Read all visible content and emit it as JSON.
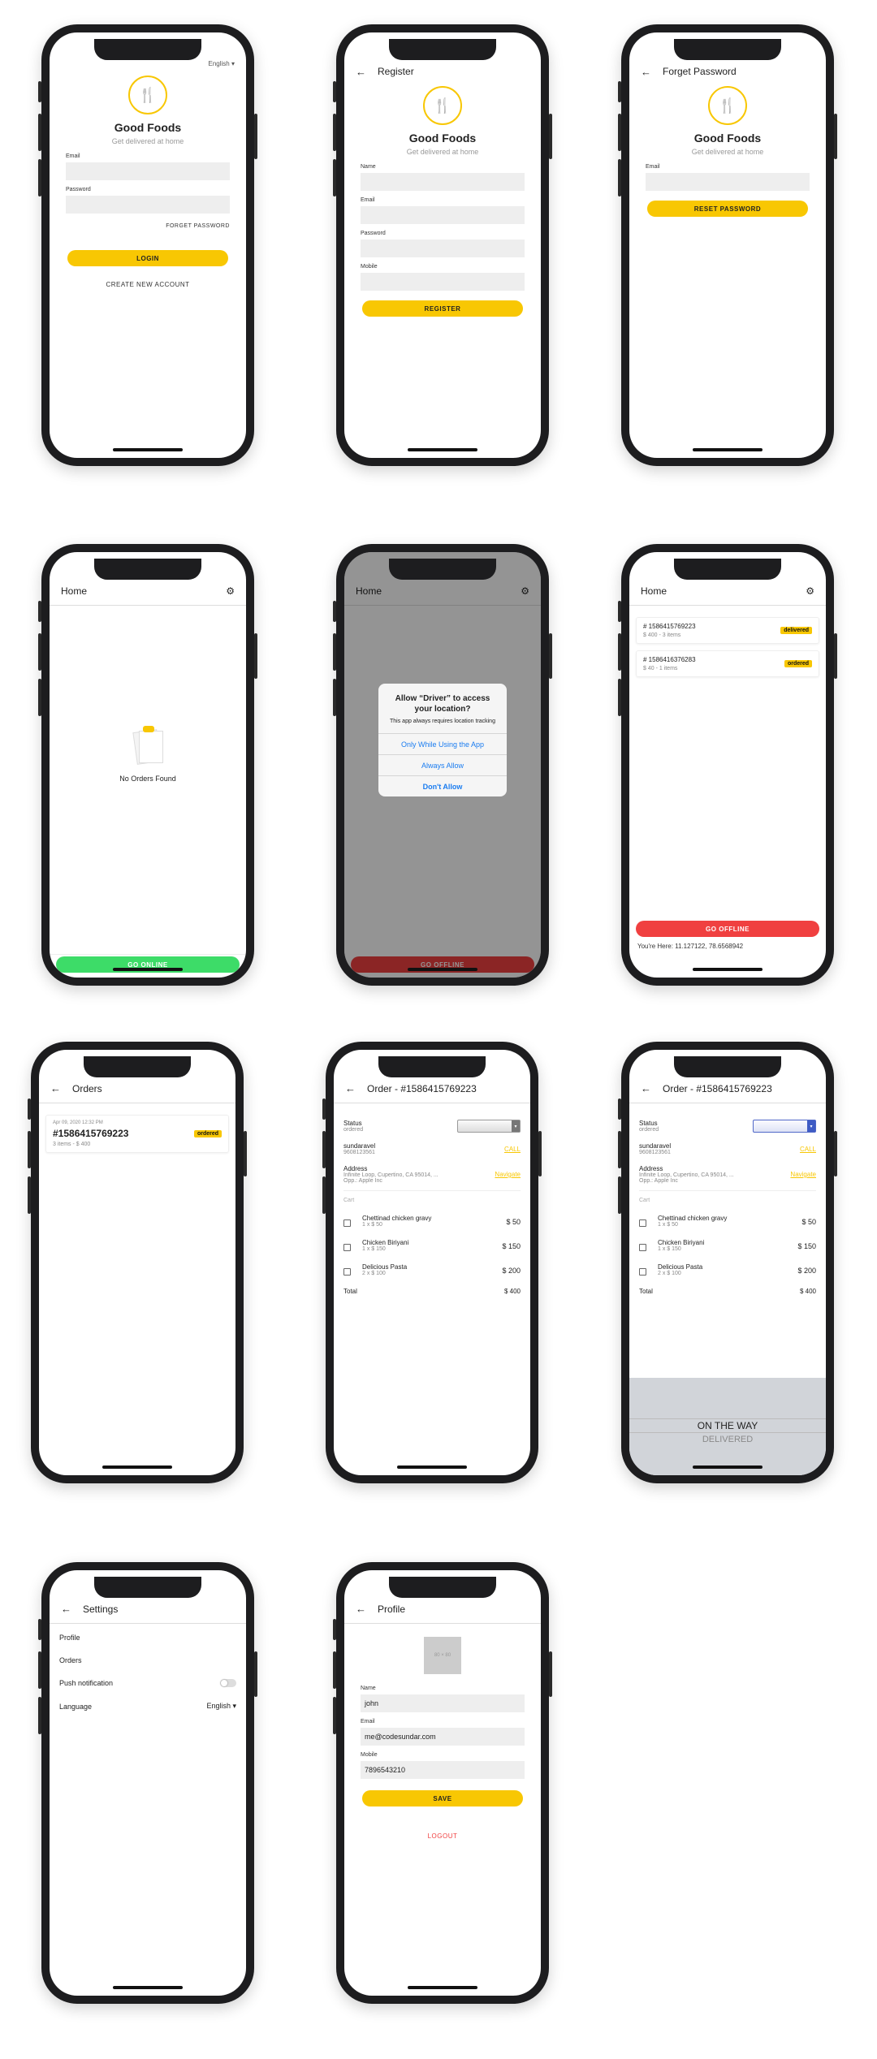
{
  "brand": {
    "name": "Good Foods",
    "tagline": "Get delivered at home",
    "accent": "#f8c703"
  },
  "login": {
    "language": "English",
    "email_label": "Email",
    "password_label": "Password",
    "forgot_link": "FORGET PASSWORD",
    "login_button": "LOGIN",
    "create_link": "CREATE NEW ACCOUNT"
  },
  "register": {
    "title": "Register",
    "name_label": "Name",
    "email_label": "Email",
    "password_label": "Password",
    "mobile_label": "Mobile",
    "register_button": "REGISTER"
  },
  "forgot": {
    "title": "Forget Password",
    "email_label": "Email",
    "reset_button": "RESET PASSWORD"
  },
  "home_empty": {
    "title": "Home",
    "empty_text": "No Orders Found",
    "go_online_button": "GO ONLINE",
    "green": "#3ddc68"
  },
  "home_alert": {
    "title": "Home",
    "alert_title": "Allow “Driver” to access your location?",
    "alert_message": "This app always requires location tracking",
    "option_1": "Only While Using the App",
    "option_2": "Always Allow",
    "option_3": "Don't Allow",
    "go_offline_button": "GO OFFLINE"
  },
  "home_orders": {
    "title": "Home",
    "orders": [
      {
        "number": "# 1586415769223",
        "summary": "$ 400 - 3 items",
        "status": "delivered"
      },
      {
        "number": "# 1586416376283",
        "summary": "$ 40 - 1 items",
        "status": "ordered"
      }
    ],
    "go_offline_button": "GO OFFLINE",
    "location_text": "You're Here: 11.127122, 78.6568942",
    "red": "#f04040"
  },
  "orders_list": {
    "title": "Orders",
    "date": "Apr 09, 2020 12:32 PM",
    "number": "#1586415769223",
    "summary": "3 items - $ 400",
    "status": "ordered"
  },
  "order_detail": {
    "title": "Order - #1586415769223",
    "status_label": "Status",
    "status_value": "ordered",
    "customer_name": "sundaravel",
    "customer_phone": "9608123561",
    "call_link": "CALL",
    "address_label": "Address",
    "address_line1": "Infinite Loop, Cupertino, CA 95014, ...",
    "address_line2": "Opp.: Apple Inc",
    "navigate_link": "Navigate",
    "cart_label": "Cart",
    "items": [
      {
        "name": "Chettinad chicken gravy",
        "qty": "1 x $ 50",
        "price": "$ 50"
      },
      {
        "name": "Chicken Biriyani",
        "qty": "1 x $ 150",
        "price": "$ 150"
      },
      {
        "name": "Delicious Pasta",
        "qty": "2 x $ 100",
        "price": "$ 200"
      }
    ],
    "total_label": "Total",
    "total_value": "$ 400",
    "picker_option_1": "ON THE WAY",
    "picker_option_2": "DELIVERED"
  },
  "settings": {
    "title": "Settings",
    "profile": "Profile",
    "orders": "Orders",
    "push": "Push notification",
    "language_label": "Language",
    "language_value": "English"
  },
  "profile": {
    "title": "Profile",
    "avatar_text": "80 × 80",
    "name_label": "Name",
    "name_value": "john",
    "email_label": "Email",
    "email_value": "me@codesundar.com",
    "mobile_label": "Mobile",
    "mobile_value": "7896543210",
    "save_button": "SAVE",
    "logout_link": "LOGOUT"
  }
}
